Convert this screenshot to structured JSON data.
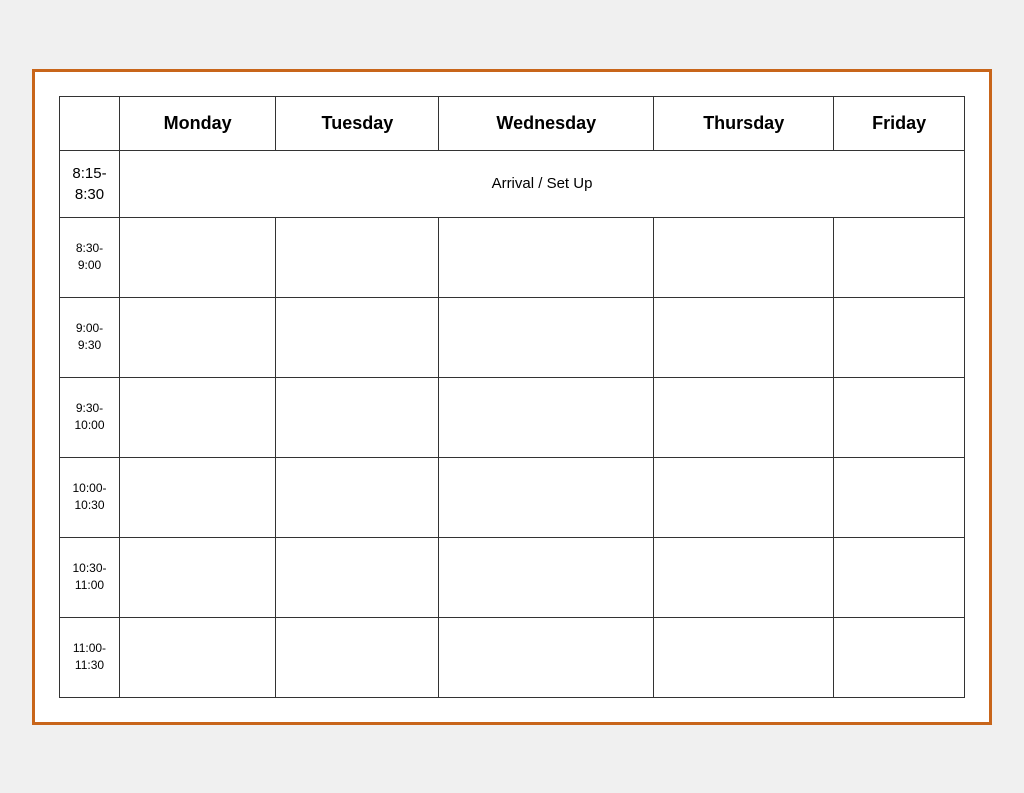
{
  "table": {
    "headers": [
      "",
      "Monday",
      "Tuesday",
      "Wednesday",
      "Thursday",
      "Friday"
    ],
    "arrival_label": "Arrival / Set Up",
    "arrival_time": "8:15-\n8:30",
    "time_slots": [
      "8:30-\n9:00",
      "9:00-\n9:30",
      "9:30-\n10:00",
      "10:00-\n10:30",
      "10:30-\n11:00",
      "11:00-\n11:30"
    ]
  }
}
